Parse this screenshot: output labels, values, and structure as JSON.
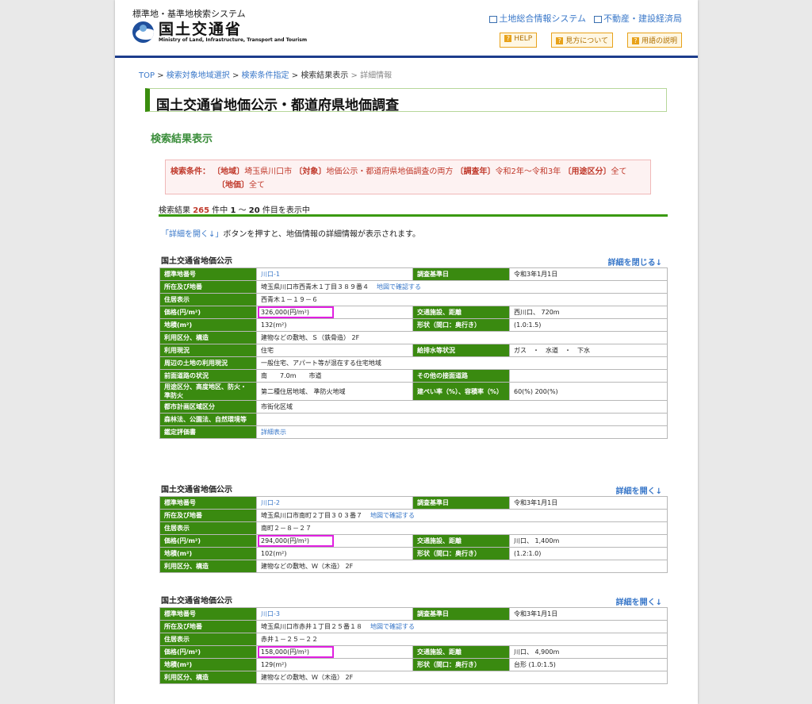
{
  "header": {
    "system_title": "標準地・基準地検索システム",
    "logo_jp": "国土交通省",
    "logo_en": "Ministry of Land, Infrastructure, Transport and Tourism",
    "links": [
      "土地総合情報システム",
      "不動産・建設経済局"
    ],
    "buttons": [
      "HELP",
      "見方について",
      "用語の説明"
    ]
  },
  "breadcrumb": {
    "items": [
      "TOP",
      "検索対象地域選択",
      "検索条件指定",
      "検索結果表示",
      "詳細情報"
    ],
    "sep": ">"
  },
  "page_title": "国土交通省地価公示・都道府県地価調査",
  "subtitle": "検索結果表示",
  "conditions": {
    "label": "検索条件：",
    "region_label": "〔地域〕",
    "region": "埼玉県川口市",
    "target_label": "〔対象〕",
    "target": "地価公示・都道府県地価調査の両方",
    "year_label": "〔調査年〕",
    "year": "令和2年～令和3年",
    "use_label": "〔用途区分〕",
    "use": "全て",
    "price_label": "〔地価〕",
    "price": "全て"
  },
  "count": {
    "prefix": "検索結果",
    "total": "265",
    "mid": "件中",
    "from": "1",
    "tilde": "～",
    "to": "20",
    "suffix": "件目を表示中"
  },
  "note": {
    "link": "「詳細を開く↓」",
    "text": "ボタンを押すと、地価情報の詳細情報が表示されます。"
  },
  "records": [
    {
      "section": "国土交通省地価公示",
      "toggle": "詳細を閉じる↓",
      "rows": [
        {
          "h1": "標準地番号",
          "v1": "川口-1",
          "h2": "調査基準日",
          "v2": "令和3年1月1日"
        },
        {
          "h1": "所在及び地番",
          "v1": "埼玉県川口市西青木１丁目３８９番４",
          "map": "地図で確認する"
        },
        {
          "h1": "住居表示",
          "v1": "西青木１－１９－６"
        },
        {
          "h1": "価格(円/m²)",
          "v1": "326,000(円/m²)",
          "h2": "交通施設、距離",
          "v2": "西川口、 720m"
        },
        {
          "h1": "地積(m²)",
          "v1": "132(m²)",
          "h2": "形状（間口：奥行き）",
          "v2": "(1.0:1.5)"
        },
        {
          "h1": "利用区分、構造",
          "v1": "建物などの敷地、Ｓ（鉄骨造） 2F"
        },
        {
          "h1": "利用現況",
          "v1": "住宅",
          "h2": "給排水等状況",
          "v2": "ガス　・　水道　・　下水"
        },
        {
          "h1": "周辺の土地の利用現況",
          "v1": "一般住宅、アパート等が混在する住宅地域"
        },
        {
          "h1": "前面道路の状況",
          "v1": "南　　7.0m　　市道",
          "h2": "その他の接面道路",
          "v2": ""
        },
        {
          "h1": "用途区分、高度地区、防火・準防火",
          "v1": "第二種住居地域、 準防火地域",
          "h2": "建ぺい率（%）、容積率（%）",
          "v2": "60(%) 200(%)"
        },
        {
          "h1": "都市計画区域区分",
          "v1": "市街化区域"
        },
        {
          "h1": "森林法、公園法、自然環境等",
          "v1": ""
        },
        {
          "h1": "鑑定評価書",
          "v1": "詳細表示"
        }
      ]
    },
    {
      "section": "国土交通省地価公示",
      "toggle": "詳細を開く↓",
      "rows": [
        {
          "h1": "標準地番号",
          "v1": "川口-2",
          "h2": "調査基準日",
          "v2": "令和3年1月1日"
        },
        {
          "h1": "所在及び地番",
          "v1": "埼玉県川口市南町２丁目３０３番７",
          "map": "地図で確認する"
        },
        {
          "h1": "住居表示",
          "v1": "南町２－８－２７"
        },
        {
          "h1": "価格(円/m²)",
          "v1": "294,000(円/m²)",
          "h2": "交通施設、距離",
          "v2": "川口、 1,400m"
        },
        {
          "h1": "地積(m²)",
          "v1": "102(m²)",
          "h2": "形状（間口：奥行き）",
          "v2": "(1.2:1.0)"
        },
        {
          "h1": "利用区分、構造",
          "v1": "建物などの敷地、Ｗ（木造） 2F"
        }
      ]
    },
    {
      "section": "国土交通省地価公示",
      "toggle": "詳細を開く↓",
      "rows": [
        {
          "h1": "標準地番号",
          "v1": "川口-3",
          "h2": "調査基準日",
          "v2": "令和3年1月1日"
        },
        {
          "h1": "所在及び地番",
          "v1": "埼玉県川口市赤井１丁目２５番１８",
          "map": "地図で確認する"
        },
        {
          "h1": "住居表示",
          "v1": "赤井１－２５－２２"
        },
        {
          "h1": "価格(円/m²)",
          "v1": "158,000(円/m²)",
          "h2": "交通施設、距離",
          "v2": "川口、 4,900m"
        },
        {
          "h1": "地積(m²)",
          "v1": "129(m²)",
          "h2": "形状（間口：奥行き）",
          "v2": "台形 (1.0:1.5)"
        },
        {
          "h1": "利用区分、構造",
          "v1": "建物などの敷地、Ｗ（木造） 2F"
        }
      ]
    }
  ]
}
